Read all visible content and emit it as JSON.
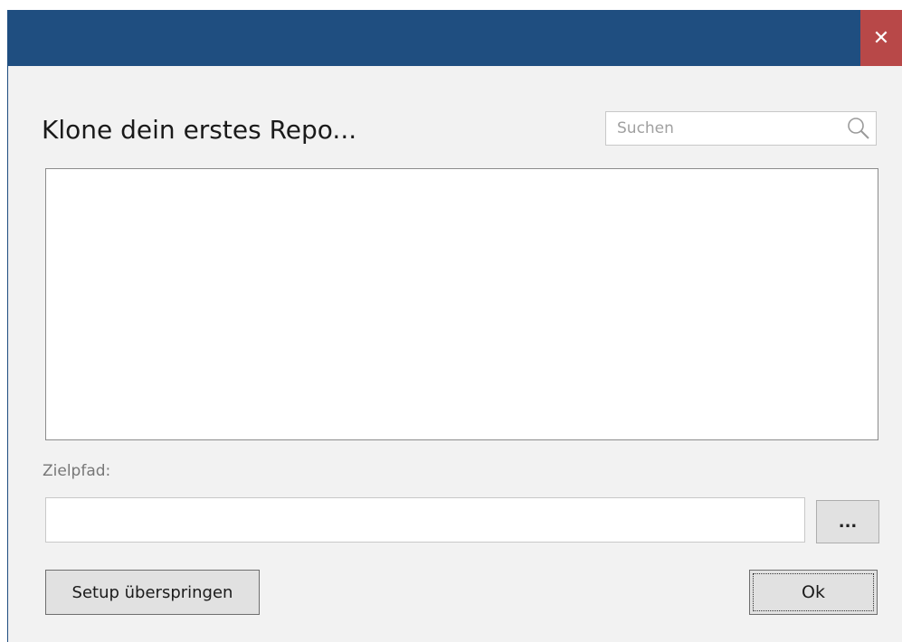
{
  "titlebar": {
    "close_label": "✕",
    "background": "#1f4e80",
    "close_background": "#b84848"
  },
  "main": {
    "heading": "Klone dein erstes Repo...",
    "search": {
      "placeholder": "Suchen",
      "value": "",
      "icon": "search-icon"
    },
    "repo_list": {
      "items": []
    },
    "target_path": {
      "label": "Zielpfad:",
      "value": "",
      "browse_label": "..."
    }
  },
  "footer": {
    "skip_label": "Setup überspringen",
    "ok_label": "Ok"
  }
}
